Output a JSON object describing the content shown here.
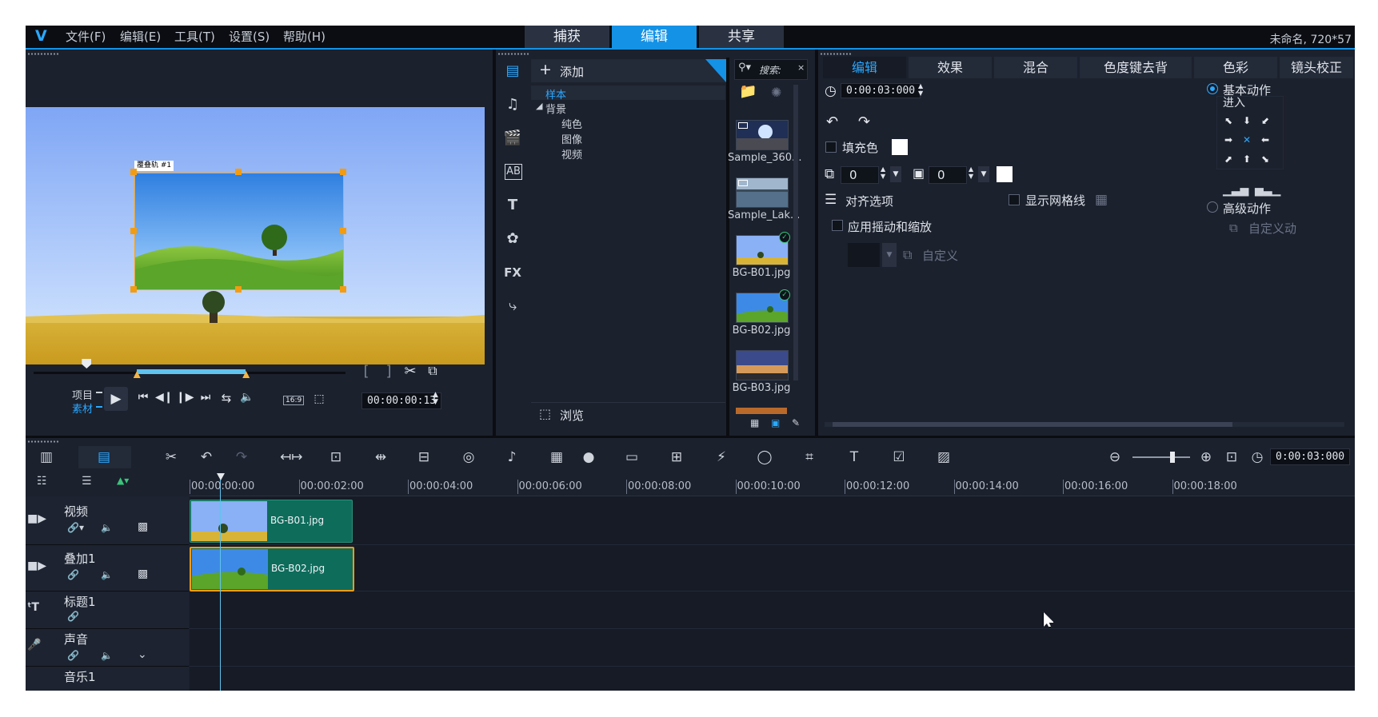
{
  "menu": {
    "items": [
      "文件(F)",
      "编辑(E)",
      "工具(T)",
      "设置(S)",
      "帮助(H)"
    ],
    "logo": "V"
  },
  "mode_tabs": [
    "捕获",
    "编辑",
    "共享"
  ],
  "active_mode": "编辑",
  "project_title": "未命名, 720*57",
  "preview": {
    "overlay_tag": "覆叠轨 #1",
    "project_label": "项目",
    "clip_label": "素材",
    "timecode": "00:00:00:13",
    "aspect": "16:9",
    "trim_start": "[",
    "trim_end": "]",
    "scrub_position": 0.17,
    "selection_range": [
      0.33,
      0.68
    ]
  },
  "library": {
    "add_label": "添加",
    "search_placeholder": "搜索:",
    "browse_label": "浏览",
    "tree": {
      "sample": "样本",
      "background": "背景",
      "children": [
        "纯色",
        "图像",
        "视频"
      ]
    },
    "thumbnails": [
      {
        "label": "Sample_360...",
        "checked": false
      },
      {
        "label": "Sample_Lak...",
        "checked": false
      },
      {
        "label": "BG-B01.jpg",
        "checked": true
      },
      {
        "label": "BG-B02.jpg",
        "checked": true
      },
      {
        "label": "BG-B03.jpg",
        "checked": false
      }
    ],
    "side_icons": [
      "media-icon",
      "audio-icon",
      "instant-project-icon",
      "transition-icon",
      "title-icon",
      "graphics-icon",
      "filter-icon",
      "path-icon"
    ],
    "side_labels": {
      "transition": "AB",
      "title": "T",
      "filter": "FX"
    }
  },
  "options": {
    "tabs": [
      "编辑",
      "效果",
      "混合",
      "色度键去背",
      "色彩",
      "镜头校正"
    ],
    "active_tab": "编辑",
    "duration": "0:00:03:000",
    "fill_color_label": "填充色",
    "border_value": "0",
    "shadow_value": "0",
    "align_label": "对齐选项",
    "grid_label": "显示网格线",
    "pan_zoom_label": "应用摇动和缩放",
    "custom_label": "自定义",
    "basic_motion_label": "基本动作",
    "enter_label": "进入",
    "advanced_motion_label": "高级动作",
    "custom_motion_label": "自定义动",
    "basic_motion_selected": true
  },
  "timeline": {
    "end_time": "0:00:03:000",
    "ruler": [
      "00:00:00:00",
      "00:00:02:00",
      "00:00:04:00",
      "00:00:06:00",
      "00:00:08:00",
      "00:00:10:00",
      "00:00:12:00",
      "00:00:14:00",
      "00:00:16:00",
      "00:00:18:00"
    ],
    "tracks": [
      {
        "name": "视频",
        "clip": "BG-B01.jpg"
      },
      {
        "name": "叠加1",
        "clip": "BG-B02.jpg"
      },
      {
        "name": "标题1",
        "clip": ""
      },
      {
        "name": "声音",
        "clip": ""
      },
      {
        "name": "音乐1",
        "clip": ""
      }
    ],
    "zoom_level": 0.7
  },
  "colors": {
    "accent": "#1492e6",
    "clip": "#0e6c5b",
    "selection": "#5fc3ee",
    "handle": "#f39c12"
  }
}
